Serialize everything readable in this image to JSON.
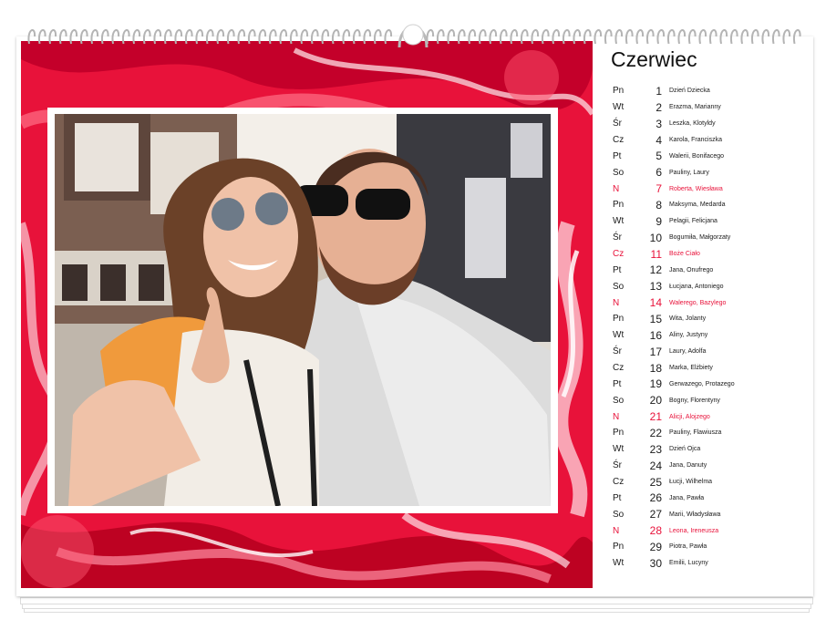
{
  "calendar": {
    "month": "Czerwiec",
    "accent_color": "#e8123a",
    "days": [
      {
        "weekday": "Pn",
        "day": "1",
        "names": "Dzień Dziecka",
        "sunday": false
      },
      {
        "weekday": "Wt",
        "day": "2",
        "names": "Erazma, Marianny",
        "sunday": false
      },
      {
        "weekday": "Śr",
        "day": "3",
        "names": "Leszka, Klotyldy",
        "sunday": false
      },
      {
        "weekday": "Cz",
        "day": "4",
        "names": "Karola, Franciszka",
        "sunday": false
      },
      {
        "weekday": "Pt",
        "day": "5",
        "names": "Walerii, Bonifacego",
        "sunday": false
      },
      {
        "weekday": "So",
        "day": "6",
        "names": "Pauliny, Laury",
        "sunday": false
      },
      {
        "weekday": "N",
        "day": "7",
        "names": "Roberta, Wiesława",
        "sunday": true
      },
      {
        "weekday": "Pn",
        "day": "8",
        "names": "Maksyma, Medarda",
        "sunday": false
      },
      {
        "weekday": "Wt",
        "day": "9",
        "names": "Pelagii, Felicjana",
        "sunday": false
      },
      {
        "weekday": "Śr",
        "day": "10",
        "names": "Bogumiła, Małgorzaty",
        "sunday": false
      },
      {
        "weekday": "Cz",
        "day": "11",
        "names": "Boże Ciało",
        "sunday": true
      },
      {
        "weekday": "Pt",
        "day": "12",
        "names": "Jana, Onufrego",
        "sunday": false
      },
      {
        "weekday": "So",
        "day": "13",
        "names": "Łucjana, Antoniego",
        "sunday": false
      },
      {
        "weekday": "N",
        "day": "14",
        "names": "Walerego, Bazylego",
        "sunday": true
      },
      {
        "weekday": "Pn",
        "day": "15",
        "names": "Wita, Jolanty",
        "sunday": false
      },
      {
        "weekday": "Wt",
        "day": "16",
        "names": "Aliny, Justyny",
        "sunday": false
      },
      {
        "weekday": "Śr",
        "day": "17",
        "names": "Laury, Adolfa",
        "sunday": false
      },
      {
        "weekday": "Cz",
        "day": "18",
        "names": "Marka, Elżbiety",
        "sunday": false
      },
      {
        "weekday": "Pt",
        "day": "19",
        "names": "Gerwazego, Protazego",
        "sunday": false
      },
      {
        "weekday": "So",
        "day": "20",
        "names": "Bogny, Florentyny",
        "sunday": false
      },
      {
        "weekday": "N",
        "day": "21",
        "names": "Alicji, Alojzego",
        "sunday": true
      },
      {
        "weekday": "Pn",
        "day": "22",
        "names": "Pauliny, Flawiusza",
        "sunday": false
      },
      {
        "weekday": "Wt",
        "day": "23",
        "names": "Dzień Ojca",
        "sunday": false
      },
      {
        "weekday": "Śr",
        "day": "24",
        "names": "Jana, Danuty",
        "sunday": false
      },
      {
        "weekday": "Cz",
        "day": "25",
        "names": "Łucji, Wilhelma",
        "sunday": false
      },
      {
        "weekday": "Pt",
        "day": "26",
        "names": "Jana, Pawła",
        "sunday": false
      },
      {
        "weekday": "So",
        "day": "27",
        "names": "Marii, Władysława",
        "sunday": false
      },
      {
        "weekday": "N",
        "day": "28",
        "names": "Leona, Ireneusza",
        "sunday": true
      },
      {
        "weekday": "Pn",
        "day": "29",
        "names": "Piotra, Pawła",
        "sunday": false
      },
      {
        "weekday": "Wt",
        "day": "30",
        "names": "Emilii, Lucyny",
        "sunday": false
      }
    ]
  }
}
